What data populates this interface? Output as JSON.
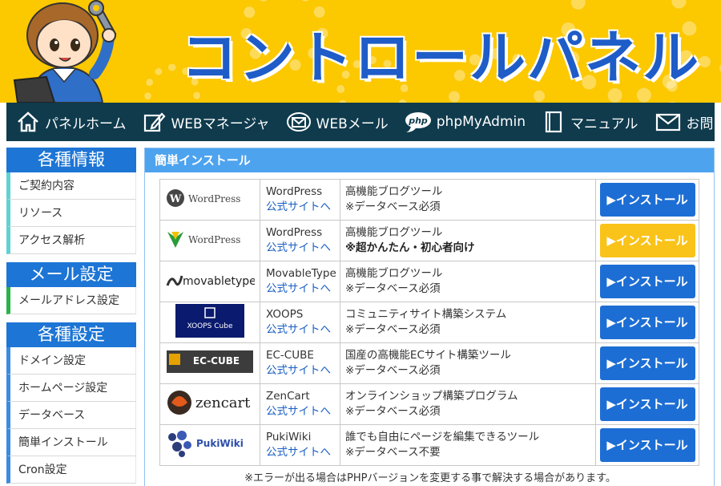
{
  "header": {
    "title": "コントロールパネル"
  },
  "nav": {
    "items": [
      {
        "label": "パネルホーム",
        "icon": "home-icon"
      },
      {
        "label": "WEBマネージャ",
        "icon": "edit-icon"
      },
      {
        "label": "WEBメール",
        "icon": "mail-globe-icon"
      },
      {
        "label": "phpMyAdmin",
        "icon": "php-icon"
      },
      {
        "label": "マニュアル",
        "icon": "book-icon"
      },
      {
        "label": "お問い合わせ",
        "icon": "envelope-icon"
      }
    ]
  },
  "sidebar": {
    "sections": [
      {
        "title": "各種情報",
        "items": [
          "ご契約内容",
          "リソース",
          "アクセス解析"
        ]
      },
      {
        "title": "メール設定",
        "items": [
          "メールアドレス設定"
        ]
      },
      {
        "title": "各種設定",
        "items": [
          "ドメイン設定",
          "ホームページ設定",
          "データベース",
          "簡単インストール",
          "Cron設定"
        ]
      }
    ]
  },
  "main": {
    "title": "簡単インストール",
    "site_link": "公式サイトへ",
    "install_label": "▶インストール",
    "note": "※エラーが出る場合はPHPバージョンを変更する事で解決する場合があります。",
    "rows": [
      {
        "logo": "WordPress",
        "name": "WordPress",
        "desc": "高機能ブログツール",
        "sub": "※データベース必須",
        "bold": false,
        "btn_color": "#1d6ed4"
      },
      {
        "logo": "WordPress",
        "name": "WordPress",
        "desc": "高機能ブログツール",
        "sub": "※超かんたん・初心者向け",
        "bold": true,
        "btn_color": "#f9c31a"
      },
      {
        "logo": "movabletype",
        "name": "MovableType",
        "desc": "高機能ブログツール",
        "sub": "※データベース必須",
        "bold": false,
        "btn_color": "#1d6ed4"
      },
      {
        "logo": "XOOPS Cube",
        "name": "XOOPS",
        "desc": "コミュニティサイト構築システム",
        "sub": "※データベース必須",
        "bold": false,
        "btn_color": "#1d6ed4"
      },
      {
        "logo": "EC-CUBE",
        "name": "EC-CUBE",
        "desc": "国産の高機能ECサイト構築ツール",
        "sub": "※データベース必須",
        "bold": false,
        "btn_color": "#1d6ed4"
      },
      {
        "logo": "zencart",
        "name": "ZenCart",
        "desc": "オンラインショップ構築プログラム",
        "sub": "※データベース必須",
        "bold": false,
        "btn_color": "#1d6ed4"
      },
      {
        "logo": "PukiWiki",
        "name": "PukiWiki",
        "desc": "誰でも自由にページを編集できるツール",
        "sub": "※データベース不要",
        "bold": false,
        "btn_color": "#1d6ed4"
      }
    ]
  },
  "colors": {
    "header_bg": "#fcc800",
    "nav_bg": "#0f3b4d",
    "accent_blue": "#1d6ed4",
    "accent_yellow": "#f9c31a"
  }
}
